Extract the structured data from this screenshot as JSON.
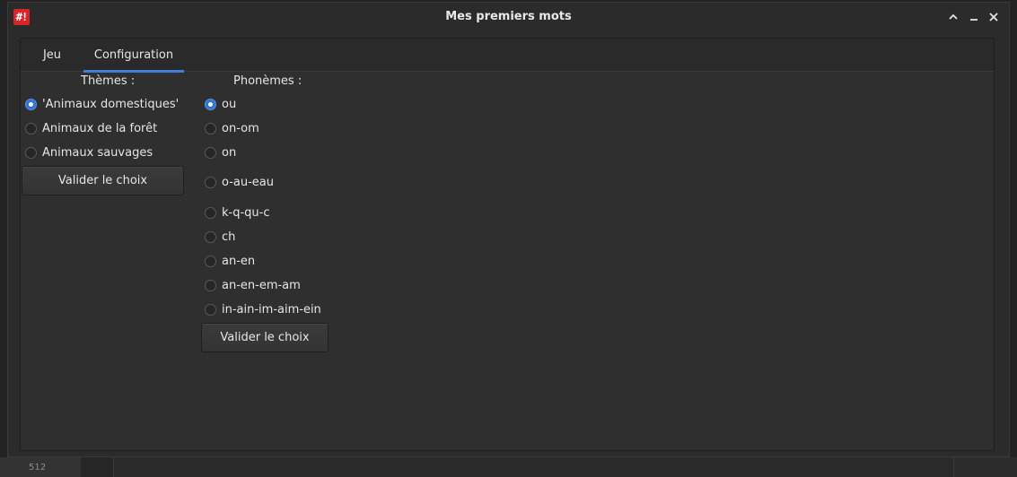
{
  "window": {
    "title": "Mes premiers mots",
    "app_icon_text": "#!"
  },
  "background": {
    "line_number": "512"
  },
  "tabs": [
    {
      "label": "Jeu",
      "active": false
    },
    {
      "label": "Configuration",
      "active": true
    }
  ],
  "themes": {
    "title": "Thèmes :",
    "options": [
      {
        "label": "'Animaux domestiques'",
        "checked": true
      },
      {
        "label": "Animaux de la forêt",
        "checked": false
      },
      {
        "label": "Animaux sauvages",
        "checked": false
      }
    ],
    "button_label": "Valider le choix"
  },
  "phonemes": {
    "title": "Phonèmes :",
    "options": [
      {
        "label": "ou",
        "checked": true
      },
      {
        "label": "on-om",
        "checked": false
      },
      {
        "label": "on",
        "checked": false
      },
      {
        "label": "o-au-eau",
        "checked": false
      },
      {
        "label": "k-q-qu-c",
        "checked": false
      },
      {
        "label": "ch",
        "checked": false
      },
      {
        "label": "an-en",
        "checked": false
      },
      {
        "label": "an-en-em-am",
        "checked": false
      },
      {
        "label": "in-ain-im-aim-ein",
        "checked": false
      }
    ],
    "button_label": "Valider le choix"
  },
  "colors": {
    "accent": "#3f7fd6",
    "radio_checked": "#2f74d3",
    "app_icon": "#d7262b"
  }
}
